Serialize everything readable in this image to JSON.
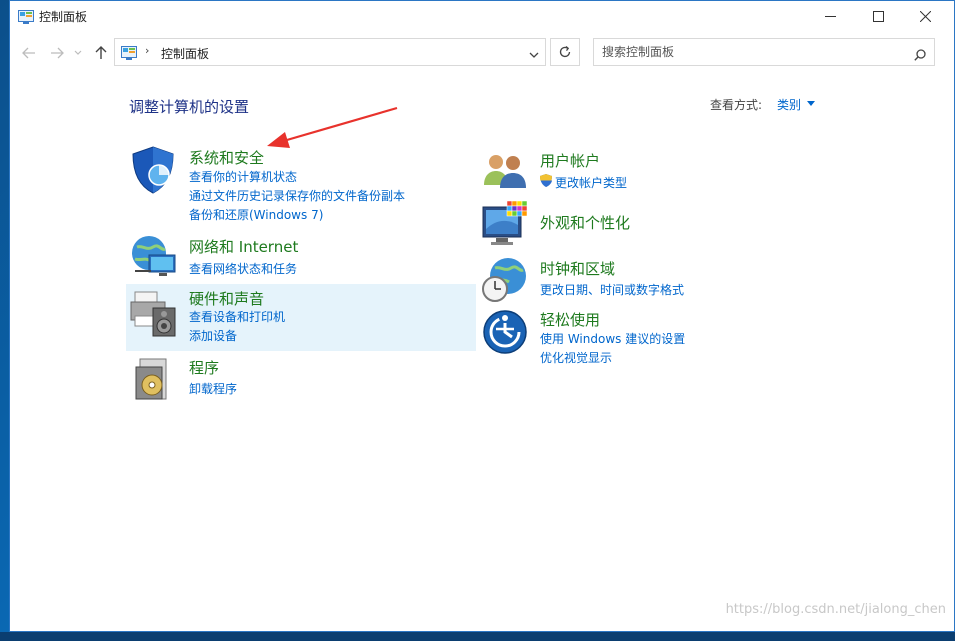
{
  "window": {
    "title": "控制面板"
  },
  "address": {
    "crumb": "控制面板",
    "separator": "›"
  },
  "search": {
    "placeholder": "搜索控制面板"
  },
  "page": {
    "heading": "调整计算机的设置"
  },
  "view_by": {
    "label": "查看方式:",
    "value": "类别"
  },
  "categories": [
    {
      "title": "系统和安全",
      "icon": "shield-icon",
      "links": [
        "查看你的计算机状态",
        "通过文件历史记录保存你的文件备份副本",
        "备份和还原(Windows 7)"
      ]
    },
    {
      "title": "网络和 Internet",
      "icon": "network-globe-icon",
      "links": [
        "查看网络状态和任务"
      ]
    },
    {
      "title": "硬件和声音",
      "icon": "printer-speaker-icon",
      "links": [
        "查看设备和打印机",
        "添加设备"
      ]
    },
    {
      "title": "程序",
      "icon": "programs-disc-icon",
      "links": [
        "卸载程序"
      ]
    },
    {
      "title": "用户帐户",
      "icon": "users-icon",
      "links": [
        "更改帐户类型"
      ]
    },
    {
      "title": "外观和个性化",
      "icon": "monitor-palette-icon",
      "links": []
    },
    {
      "title": "时钟和区域",
      "icon": "clock-globe-icon",
      "links": [
        "更改日期、时间或数字格式"
      ]
    },
    {
      "title": "轻松使用",
      "icon": "ease-of-access-icon",
      "links": [
        "使用 Windows 建议的设置",
        "优化视觉显示"
      ]
    }
  ],
  "watermark": "https://blog.csdn.net/jialong_chen",
  "colors": {
    "link": "#0066cc",
    "category_title": "#1e7a1e",
    "heading": "#1e3287",
    "highlight": "#e5f3fb",
    "annotation_arrow": "#e8322c"
  }
}
